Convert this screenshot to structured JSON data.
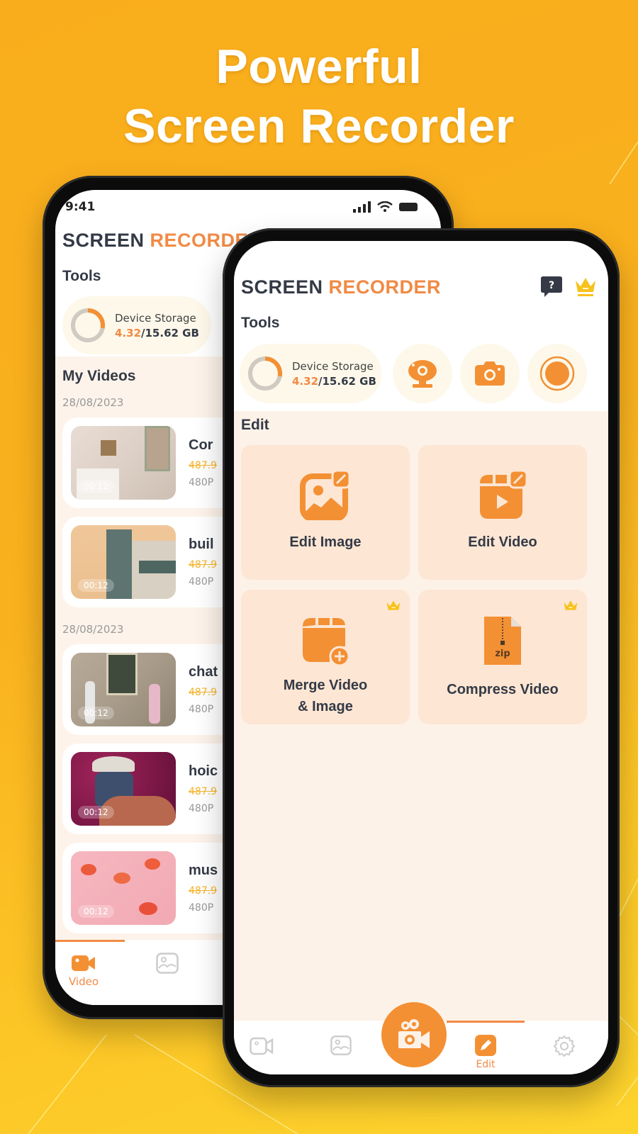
{
  "headline": {
    "line1": "Powerful",
    "line2": "Screen Recorder"
  },
  "colors": {
    "accent": "#f18a45",
    "accent_strong": "#f39034",
    "text_dark": "#343a46",
    "crown": "#f7c21a",
    "background": "#f9b11e"
  },
  "back_phone": {
    "status": {
      "time": "9:41"
    },
    "app_title": {
      "part1": "SCREEN",
      "part2": "RECORDER"
    },
    "tools_label": "Tools",
    "storage": {
      "label": "Device Storage",
      "used": "4.32",
      "total": "/15.62 GB",
      "used_fraction": 0.28
    },
    "my_videos_label": "My Videos",
    "groups": [
      {
        "date": "28/08/2023",
        "videos": [
          {
            "title": "Cor",
            "size": "487.9",
            "resolution": "480P",
            "duration": "00:12"
          },
          {
            "title": "buil",
            "size": "487.9",
            "resolution": "480P",
            "duration": "00:12"
          }
        ]
      },
      {
        "date": "28/08/2023",
        "videos": [
          {
            "title": "chat",
            "size": "487.9",
            "resolution": "480P",
            "duration": "00:12"
          },
          {
            "title": "hoic",
            "size": "487.9",
            "resolution": "480P",
            "duration": "00:12"
          },
          {
            "title": "mus",
            "size": "487.9",
            "resolution": "480P",
            "duration": "00:12"
          }
        ]
      }
    ],
    "nav": [
      {
        "label": "Video",
        "icon": "video-camera-icon",
        "active": true
      },
      {
        "label": "",
        "icon": "image-icon",
        "active": false
      }
    ]
  },
  "front_phone": {
    "app_title": {
      "part1": "SCREEN",
      "part2": "RECORDER"
    },
    "header_icons": [
      "help-chat-icon",
      "crown-icon"
    ],
    "help_glyph": "?",
    "tools_label": "Tools",
    "storage": {
      "label": "Device Storage",
      "used": "4.32",
      "total": "/15.62 GB",
      "used_fraction": 0.28
    },
    "tools": [
      {
        "name": "webcam",
        "icon": "webcam-icon"
      },
      {
        "name": "screenshot",
        "icon": "camera-icon"
      },
      {
        "name": "record",
        "icon": "record-icon"
      }
    ],
    "edit_label": "Edit",
    "edit_cards": [
      {
        "label": "Edit Image",
        "icon": "edit-image-icon",
        "premium": false
      },
      {
        "label": "Edit Video",
        "icon": "edit-video-icon",
        "premium": false
      },
      {
        "label": "Merge Video\n& Image",
        "label_line1": "Merge Video",
        "label_line2": "& Image",
        "icon": "merge-icon",
        "premium": true
      },
      {
        "label": "Compress Video",
        "icon": "zip-file-icon",
        "premium": true,
        "zip_text": "zip"
      }
    ],
    "nav": [
      {
        "label": "",
        "icon": "video-camera-icon",
        "active": false
      },
      {
        "label": "",
        "icon": "image-icon",
        "active": false
      },
      {
        "label": "",
        "icon": "record-camera-fab-icon",
        "active": false
      },
      {
        "label": "Edit",
        "icon": "edit-pencil-icon",
        "active": true
      },
      {
        "label": "",
        "icon": "settings-gear-icon",
        "active": false
      }
    ]
  }
}
